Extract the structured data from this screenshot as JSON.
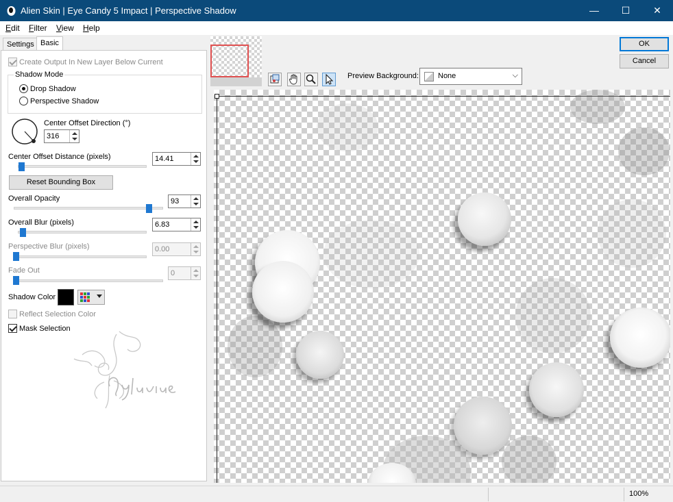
{
  "window": {
    "title": "Alien Skin | Eye Candy 5 Impact | Perspective Shadow",
    "controls": {
      "minimize": "—",
      "maximize": "☐",
      "close": "✕"
    }
  },
  "menubar": {
    "items": [
      {
        "mnemonic": "E",
        "rest": "dit"
      },
      {
        "mnemonic": "F",
        "rest": "ilter"
      },
      {
        "mnemonic": "V",
        "rest": "iew"
      },
      {
        "mnemonic": "H",
        "rest": "elp"
      }
    ]
  },
  "tabs": {
    "settings": "Settings",
    "basic": "Basic"
  },
  "basic": {
    "create_output": {
      "label": "Create Output In New Layer Below Current",
      "checked": true,
      "enabled": false
    },
    "shadow_mode": {
      "title": "Shadow Mode",
      "drop": "Drop Shadow",
      "perspective": "Perspective Shadow",
      "selected": "Drop Shadow"
    },
    "center_offset_direction": {
      "label": "Center Offset Direction (°)",
      "value": "316"
    },
    "center_offset_distance": {
      "label": "Center Offset Distance (pixels)",
      "value": "14.41"
    },
    "reset_bounding_box": "Reset Bounding Box",
    "overall_opacity": {
      "label": "Overall Opacity",
      "value": "93"
    },
    "overall_blur": {
      "label": "Overall Blur (pixels)",
      "value": "6.83"
    },
    "perspective_blur": {
      "label": "Perspective Blur (pixels)",
      "value": "0.00"
    },
    "fade_out": {
      "label": "Fade Out",
      "value": "0"
    },
    "shadow_color": {
      "label": "Shadow Color",
      "color": "#000000"
    },
    "reflect_selection_color": {
      "label": "Reflect Selection Color",
      "checked": false
    },
    "mask_selection": {
      "label": "Mask Selection",
      "checked": true
    }
  },
  "buttons": {
    "ok": "OK",
    "cancel": "Cancel"
  },
  "preview_toolbar": {
    "tools": [
      "preview-tool-icon",
      "hand-icon",
      "zoom-icon",
      "pointer-icon"
    ],
    "background_label": "Preview Background:",
    "background_value": "None"
  },
  "statusbar": {
    "zoom": "100%"
  },
  "colors": {
    "titlebar": "#0b4a7a",
    "accent": "#1f78d1",
    "default_button_border": "#0078d7"
  }
}
